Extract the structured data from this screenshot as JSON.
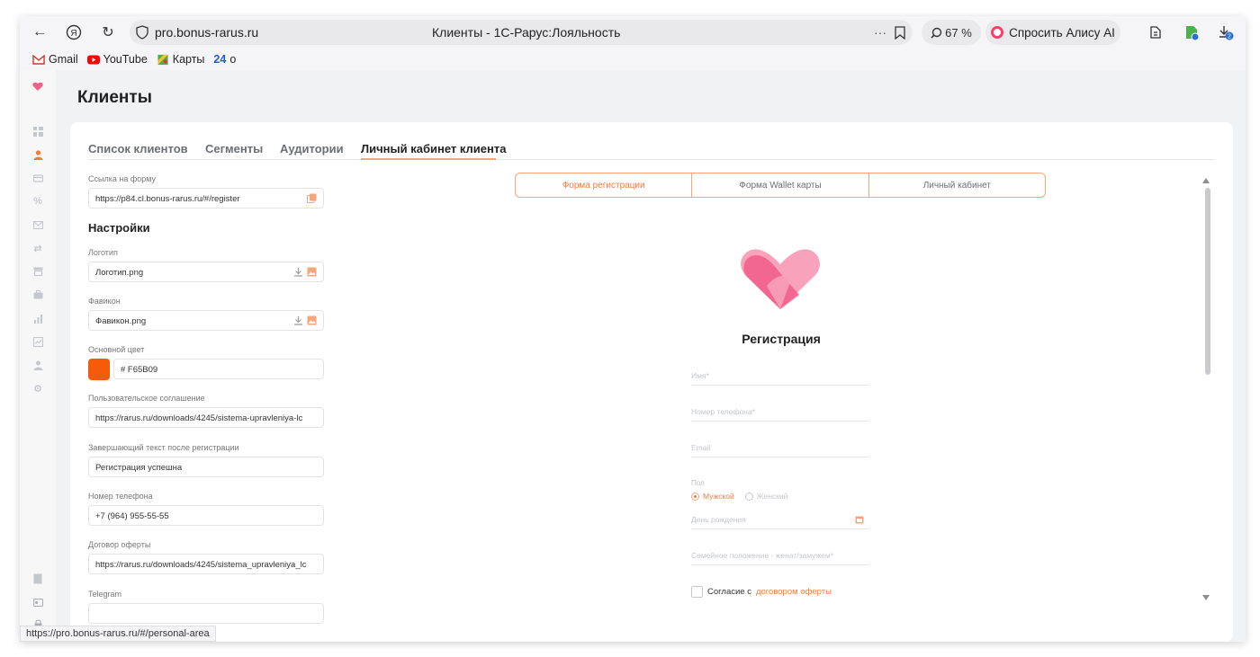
{
  "browser": {
    "url": "pro.bonus-rarus.ru",
    "page_title": "Клиенты - 1С-Рарус:Лояльность",
    "zoom": "67 %",
    "alice_label": "Спросить Алису AI",
    "download_badge": "2",
    "status_url": "https://pro.bonus-rarus.ru/#/personal-area"
  },
  "bookmarks": [
    {
      "label": "Gmail",
      "icon": "gmail-icon"
    },
    {
      "label": "YouTube",
      "icon": "youtube-icon"
    },
    {
      "label": "Карты",
      "icon": "maps-icon"
    },
    {
      "label": "о",
      "icon": "24-icon",
      "prefix": "24"
    }
  ],
  "app": {
    "title": "Клиенты",
    "tabs": [
      {
        "label": "Список клиентов"
      },
      {
        "label": "Сегменты"
      },
      {
        "label": "Аудитории"
      },
      {
        "label": "Личный кабинет клиента",
        "active": true
      }
    ]
  },
  "settings": {
    "form_link_label": "Ссылка на форму",
    "form_link_value": "https://p84.cl.bonus-rarus.ru/#/register",
    "heading": "Настройки",
    "logo_label": "Логотип",
    "logo_value": "Логотип.png",
    "favicon_label": "Фавикон",
    "favicon_value": "Фавикон.png",
    "color_label": "Основной цвет",
    "color_value": "# F65B09",
    "color_hex": "#F65B09",
    "agreement_label": "Пользовательское соглашение",
    "agreement_value": "https://rarus.ru/downloads/4245/sistema-upravleniya-lc",
    "final_text_label": "Завершающий текст после регистрации",
    "final_text_value": "Регистрация успешна",
    "phone_label": "Номер телефона",
    "phone_value": "+7 (964) 955-55-55",
    "offer_label": "Договор оферты",
    "offer_value": "https://rarus.ru/downloads/4245/sistema_upravleniya_lc",
    "telegram_label": "Telegram"
  },
  "preview": {
    "segments": [
      {
        "label": "Форма регистрации",
        "active": true
      },
      {
        "label": "Форма Wallet карты"
      },
      {
        "label": "Личный кабинет"
      }
    ],
    "title": "Регистрация",
    "fields": {
      "name": "Имя*",
      "phone": "Номер телефона*",
      "email": "Email",
      "gender_label": "Пол",
      "gender_male": "Мужской",
      "gender_female": "Женский",
      "birthday": "День рождения",
      "marital": "Семейное положение - женат/замужем*"
    },
    "consent_prefix": "Согласие с",
    "consent_link": "договором оферты"
  },
  "colors": {
    "accent": "#F37B3D",
    "heart_light": "#F8A3BB",
    "heart_dark": "#F0608C"
  }
}
